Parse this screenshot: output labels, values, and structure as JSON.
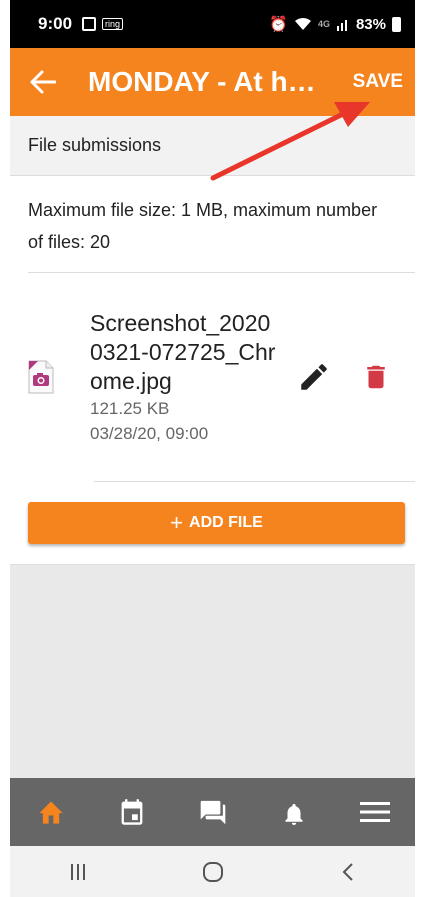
{
  "status_bar": {
    "time": "9:00",
    "ring_label": "ring",
    "network": "4G",
    "battery": "83%"
  },
  "app_bar": {
    "title": "MONDAY - At home",
    "save_label": "SAVE"
  },
  "section": {
    "header": "File submissions",
    "info": "Maximum file size: 1 MB, maximum number of files: 20"
  },
  "files": [
    {
      "name": "Screenshot_20200321-072725_Chrome.jpg",
      "size": "121.25 KB",
      "date": "03/28/20, 09:00"
    }
  ],
  "add_file_label": "ADD FILE",
  "tabs": [
    {
      "icon": "home-icon",
      "active": true
    },
    {
      "icon": "calendar-icon",
      "active": false
    },
    {
      "icon": "messages-icon",
      "active": false
    },
    {
      "icon": "notifications-icon",
      "active": false
    },
    {
      "icon": "menu-icon",
      "active": false
    }
  ],
  "colors": {
    "accent": "#f5841e",
    "delete": "#d23a45",
    "annotation_arrow": "#e8362a"
  }
}
